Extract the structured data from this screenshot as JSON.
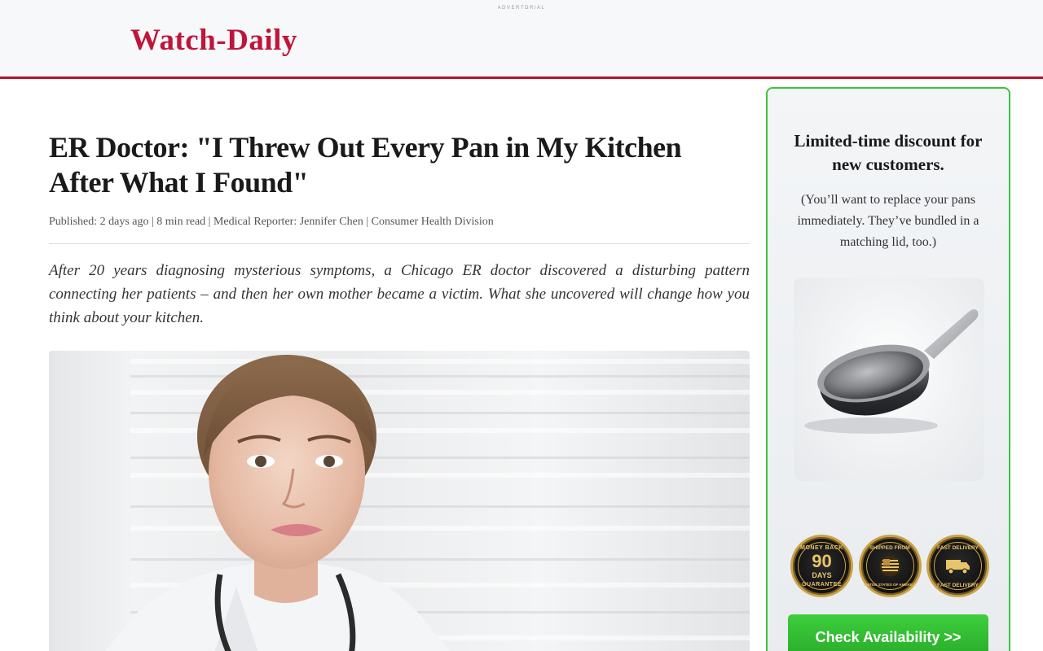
{
  "header": {
    "advertorial_label": "ADVERTORIAL",
    "brand": "Watch-Daily",
    "brand_color": "#c0153a",
    "accent_border_color": "#b5122e"
  },
  "article": {
    "headline": "ER Doctor: \"I Threw Out Every Pan in My Kitchen After What I Found\"",
    "meta": "Published: 2 days ago | 8 min read | Medical Reporter: Jennifer Chen | Consumer Health Division",
    "lede": "After 20 years diagnosing mysterious symptoms, a Chicago ER doctor discovered a disturbing pattern connecting her patients – and then her own mother became a victim. What she uncovered will change how you think about your kitchen.",
    "hero_image": "doctor-portrait"
  },
  "sidebar": {
    "title": "Limited-time discount for new customers.",
    "subtitle": "(You’ll want to replace your pans immediately. They’ve bundled in a matching lid, too.)",
    "product_image": "frying-pan",
    "badges": [
      {
        "icon": "money-back-badge-icon",
        "top_text": "MONEY BACK",
        "main": "90",
        "sub": "DAYS",
        "bottom_text": "GUARANTEE"
      },
      {
        "icon": "shipped-from-usa-badge-icon",
        "top_text": "SHIPPED FROM",
        "bottom_text": "UNITED STATES OF AMERICA"
      },
      {
        "icon": "fast-delivery-badge-icon",
        "top_text": "FAST DELIVERY",
        "bottom_text": "FAST DELIVERY"
      }
    ],
    "cta_label": "Check Availability >>",
    "cta_color": "#2fb82f",
    "border_color": "#3ec43e"
  }
}
